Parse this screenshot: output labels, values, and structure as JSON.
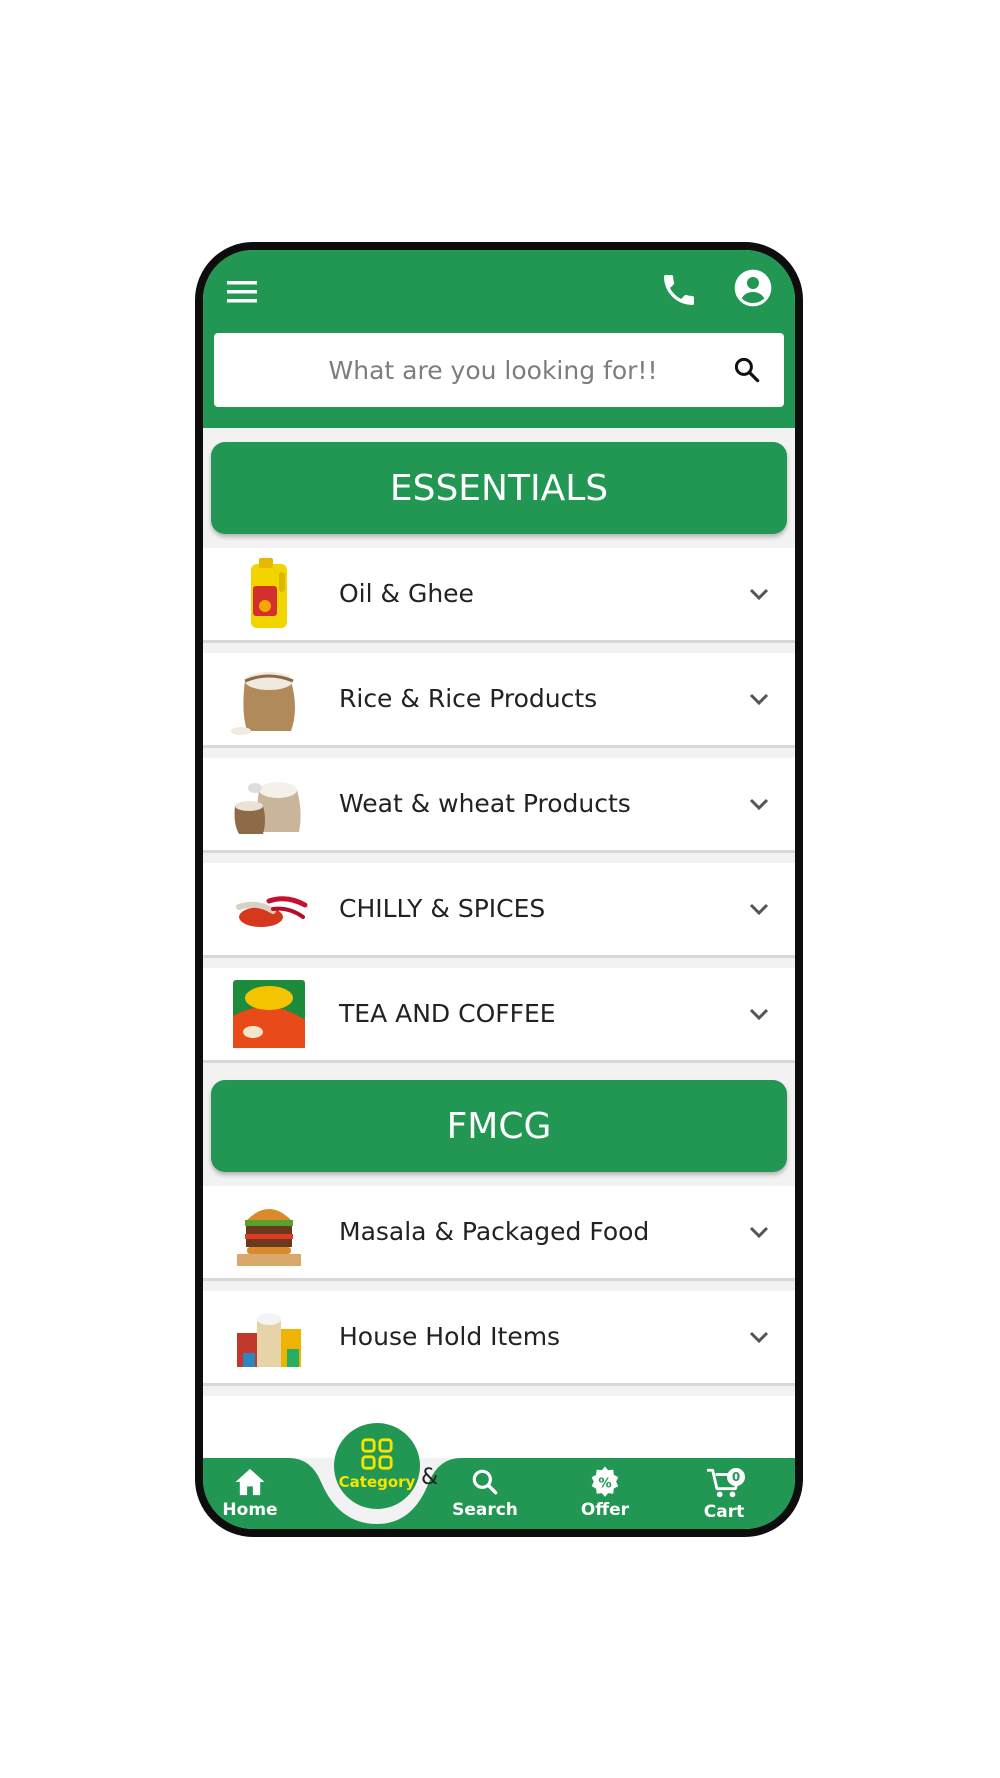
{
  "header": {
    "menu_icon": "hamburger-menu-icon",
    "call_icon": "phone-icon",
    "account_icon": "account-circle-icon",
    "colors": {
      "primary": "#229653",
      "accent": "#f5e600"
    }
  },
  "search": {
    "placeholder": "What are you looking for!!",
    "value": "",
    "icon": "search-icon"
  },
  "sections": [
    {
      "title": "ESSENTIALS",
      "items": [
        {
          "label": "Oil & Ghee",
          "image": "oil-can-image"
        },
        {
          "label": "Rice & Rice Products",
          "image": "rice-sack-image"
        },
        {
          "label": "Weat & wheat Products",
          "image": "wheat-flour-image"
        },
        {
          "label": "CHILLY & SPICES",
          "image": "chilli-spice-image"
        },
        {
          "label": "TEA AND COFFEE",
          "image": "tea-pack-image"
        }
      ]
    },
    {
      "title": "FMCG",
      "items": [
        {
          "label": "Masala & Packaged Food",
          "image": "burger-image"
        },
        {
          "label": "House Hold Items",
          "image": "household-items-image"
        }
      ]
    }
  ],
  "bottom_nav": {
    "home": "Home",
    "category": "Category",
    "search": "Search",
    "offer": "Offer",
    "cart": "Cart",
    "cart_count": "0",
    "stray_text": "&"
  }
}
